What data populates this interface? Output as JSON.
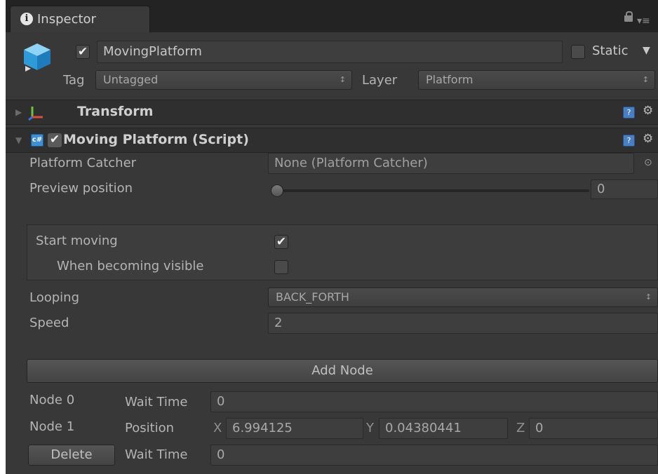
{
  "window": {
    "tab_title": "Inspector",
    "menu_glyph": "▾≡"
  },
  "gameobject": {
    "active_check": "✔",
    "name": "MovingPlatform",
    "static_label": "Static",
    "static_arrow": "▼",
    "tag_label": "Tag",
    "tag_value": "Untagged",
    "layer_label": "Layer",
    "layer_value": "Platform",
    "dropdown_arrow": "↕"
  },
  "transform": {
    "title": "Transform",
    "fold": "▶"
  },
  "script": {
    "fold": "▼",
    "enabled_check": "✔",
    "title": "Moving Platform (Script)",
    "icon_glyph": "c#",
    "help_glyph": "?",
    "gear_glyph": "⚙",
    "platform_catcher_label": "Platform Catcher",
    "platform_catcher_value": "None (Platform Catcher)",
    "object_picker_glyph": "⊙",
    "preview_label": "Preview position",
    "preview_value": "0",
    "preview_fraction": 0,
    "start_moving_label": "Start moving",
    "start_moving_check": "✔",
    "start_moving_checked": true,
    "visible_label": "When becoming visible",
    "visible_checked": false,
    "looping_label": "Looping",
    "looping_value": "BACK_FORTH",
    "speed_label": "Speed",
    "speed_value": "2",
    "add_node_label": "Add Node"
  },
  "nodes": [
    {
      "label": "Node 0",
      "wait_label": "Wait Time",
      "wait_value": "0"
    },
    {
      "label": "Node 1",
      "position_label": "Position",
      "x_label": "X",
      "x_value": "6.994125",
      "y_label": "Y",
      "y_value": "0.04380441",
      "z_label": "Z",
      "z_value": "0",
      "delete_label": "Delete",
      "wait_label": "Wait Time",
      "wait_value": "0"
    }
  ],
  "colors": {
    "panel_bg": "#383838",
    "header_bg": "#2f2f2f",
    "field_bg": "#3e3e3e",
    "help_blue": "#4b7fc4"
  }
}
